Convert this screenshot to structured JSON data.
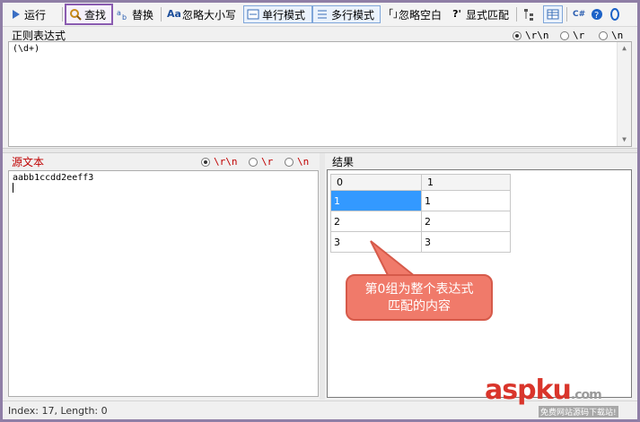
{
  "toolbar": {
    "run": "运行",
    "find": "查找",
    "replace": "替换",
    "ignore_case": "忽略大小写",
    "single_line": "单行模式",
    "multi_line": "多行模式",
    "ignore_space": "忽略空白",
    "explicit_match": "显式匹配"
  },
  "regex": {
    "label": "正则表达式",
    "value": "(\\d+)",
    "newline_options": [
      "\\r\\n",
      "\\r",
      "\\n"
    ],
    "selected_newline": "\\r\\n"
  },
  "source": {
    "label": "源文本",
    "value": "aabb1ccdd2eeff3",
    "newline_options": [
      "\\r\\n",
      "\\r",
      "\\n"
    ],
    "selected_newline": "\\r\\n"
  },
  "results": {
    "label": "结果",
    "columns": [
      "0",
      "1"
    ],
    "rows": [
      [
        "1",
        "1"
      ],
      [
        "2",
        "2"
      ],
      [
        "3",
        "3"
      ]
    ]
  },
  "callout": {
    "line1": "第0组为整个表达式",
    "line2": "匹配的内容"
  },
  "status": {
    "text": "Index: 17, Length: 0"
  },
  "watermark": {
    "brand": "aspku",
    "suffix": ".com",
    "tagline": "免费网站源码下载站!"
  },
  "colors": {
    "source_label": "#c00000",
    "highlight_border": "#8a5bb0",
    "selection": "#3399ff",
    "callout": "#f07a6a"
  }
}
